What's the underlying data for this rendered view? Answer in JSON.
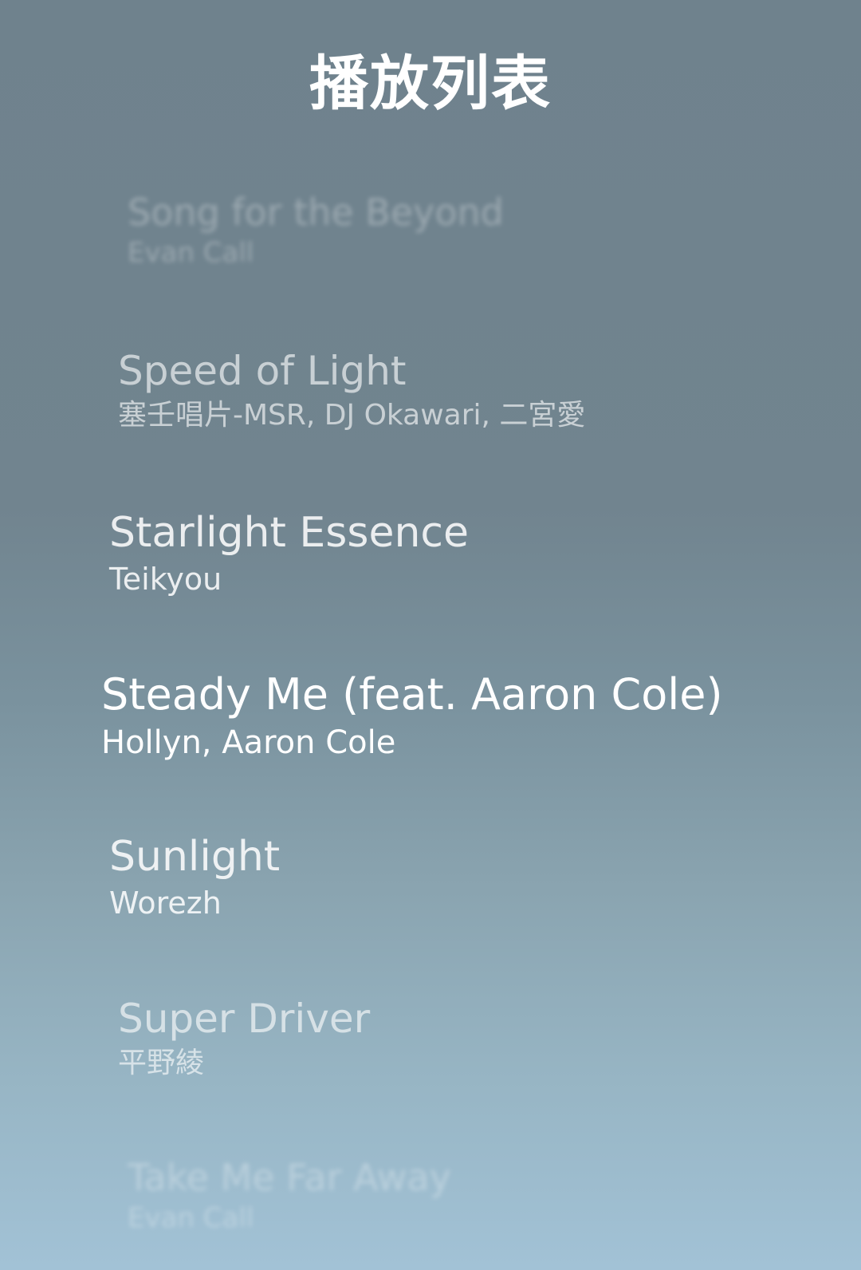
{
  "header": {
    "title": "播放列表"
  },
  "playlist": {
    "tracks": [
      {
        "title": "Song for the Beyond",
        "artist": "Evan Call"
      },
      {
        "title": "Speed of Light",
        "artist": "塞壬唱片-MSR, DJ Okawari, 二宮愛"
      },
      {
        "title": "Starlight Essence",
        "artist": "Teikyou"
      },
      {
        "title": "Steady Me (feat. Aaron Cole)",
        "artist": "Hollyn, Aaron Cole"
      },
      {
        "title": "Sunlight",
        "artist": "Worezh"
      },
      {
        "title": "Super Driver",
        "artist": "平野綾"
      },
      {
        "title": "Take Me Far Away",
        "artist": "Evan Call"
      }
    ],
    "current_index": 3
  },
  "colors": {
    "text": "#ffffff",
    "background_top": "#6f828d",
    "background_bottom": "#a2c2d6"
  }
}
